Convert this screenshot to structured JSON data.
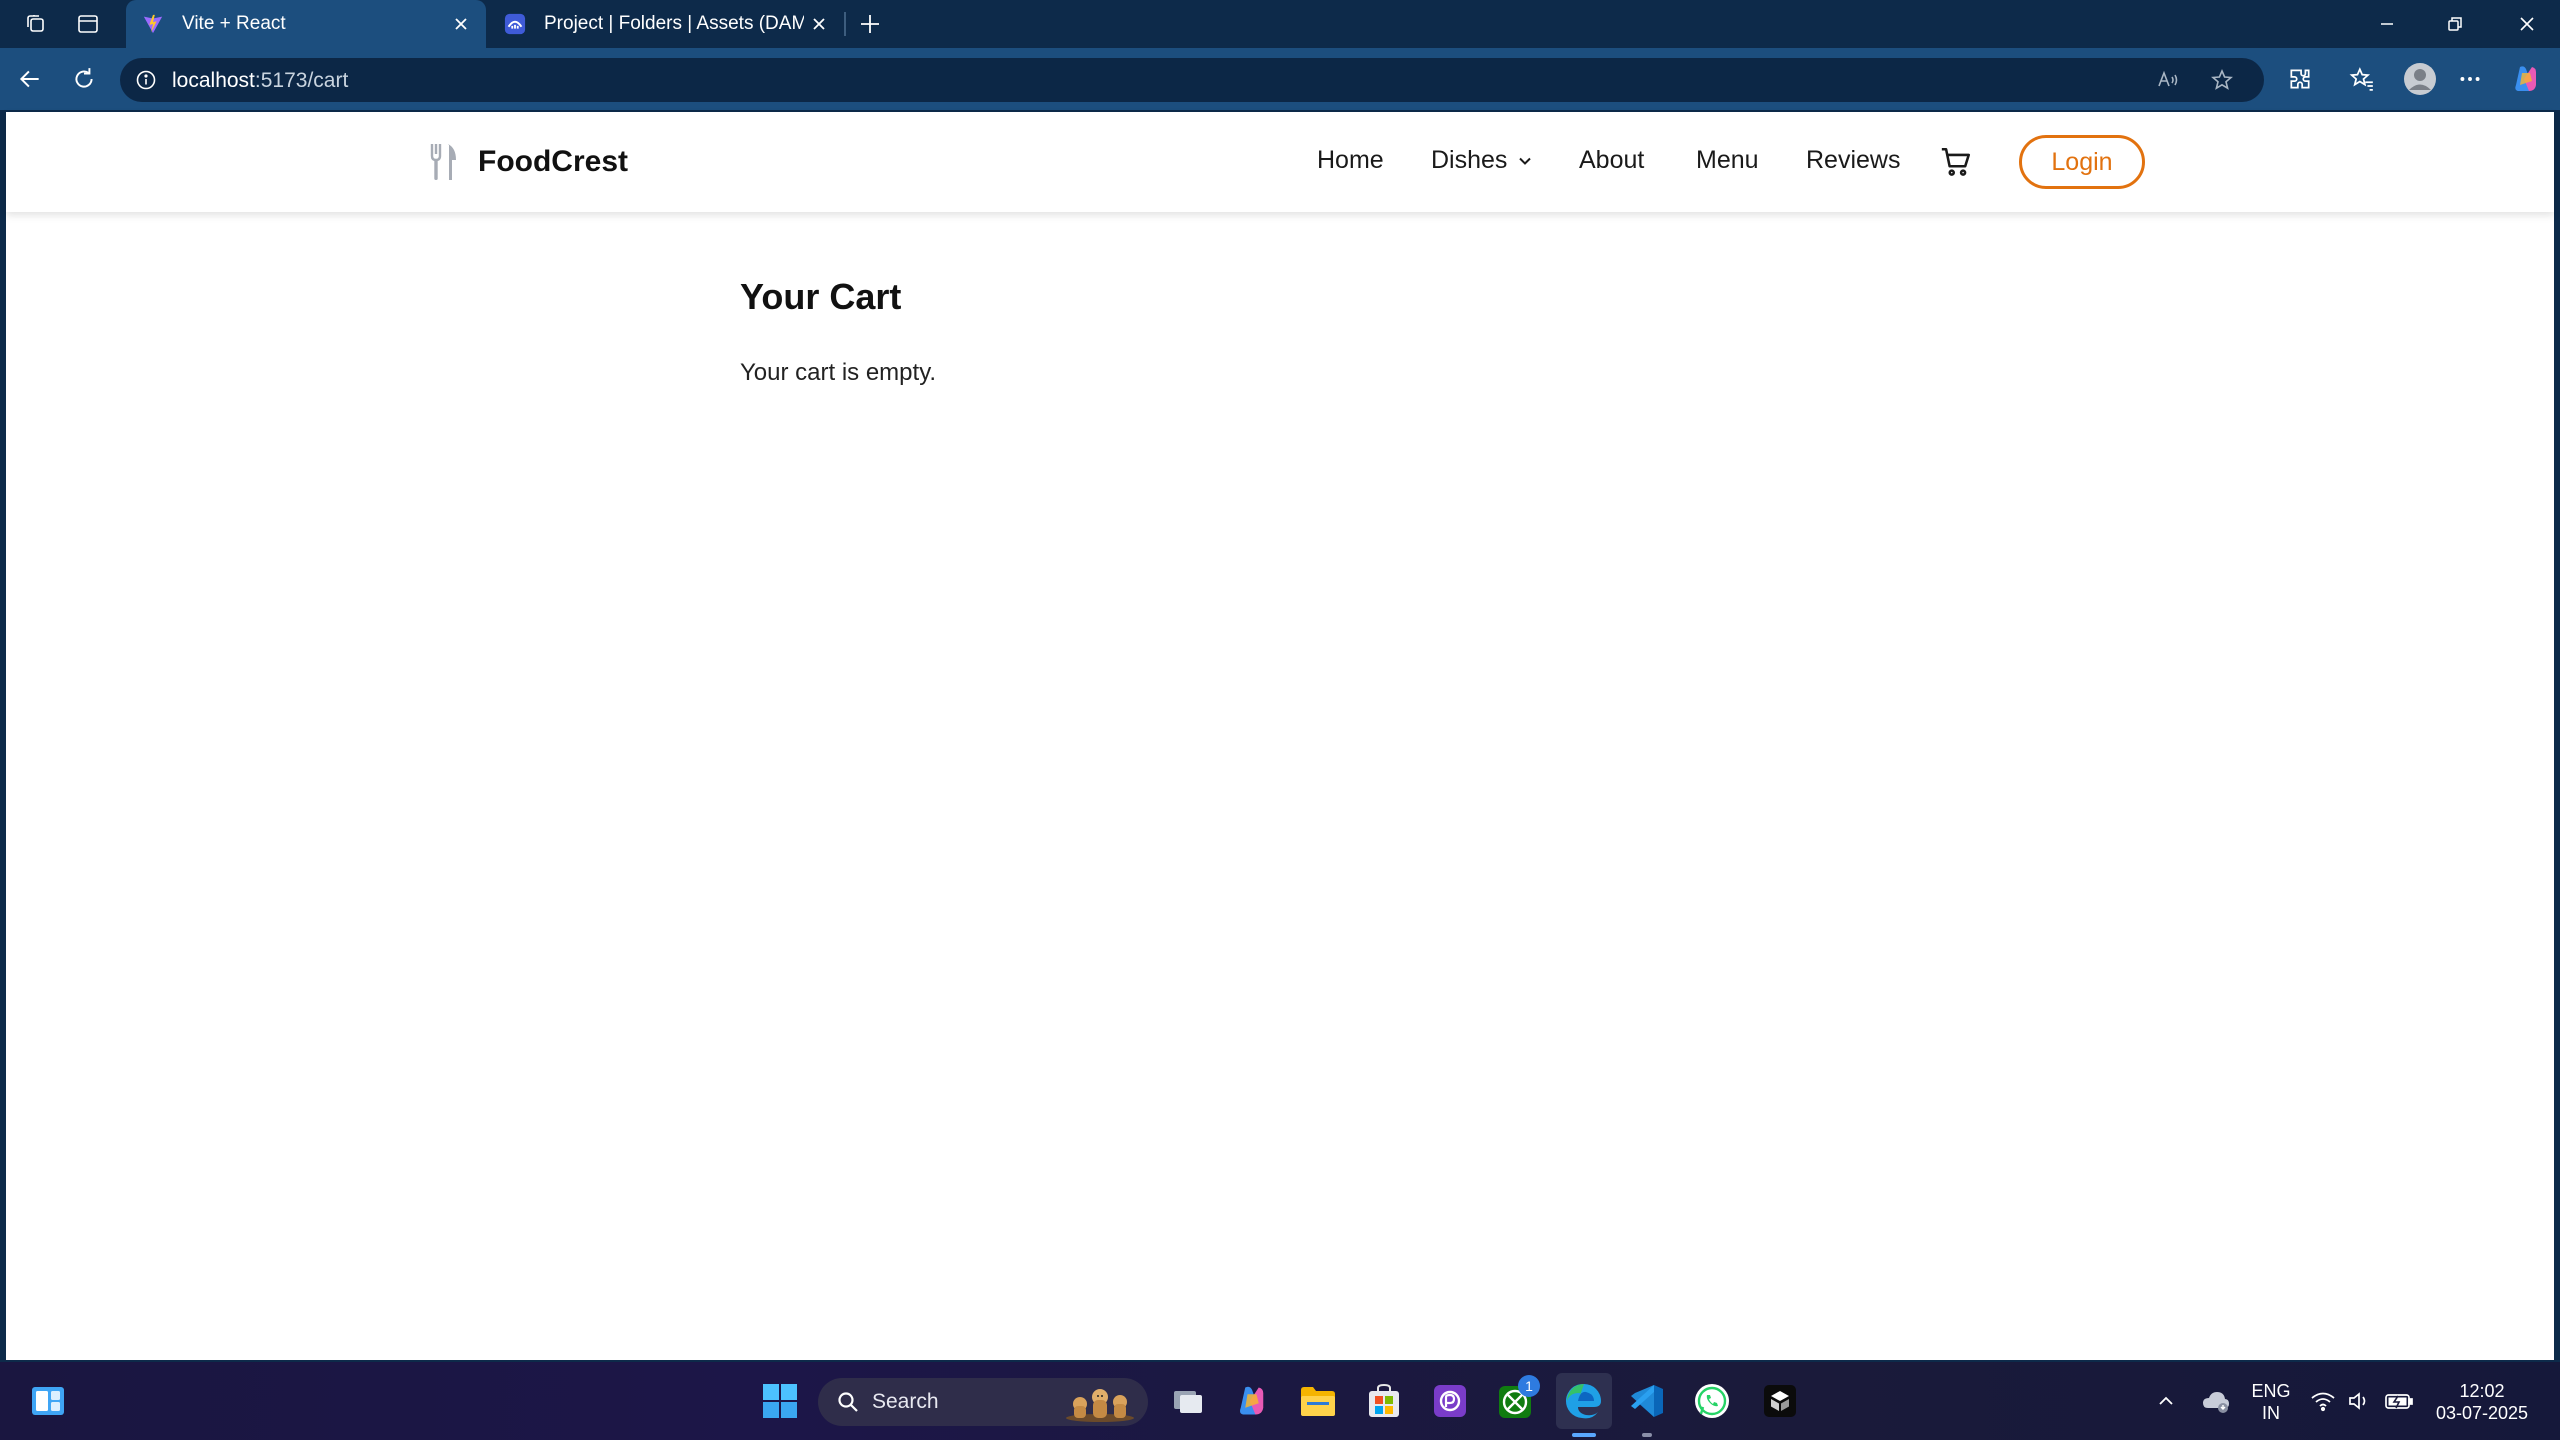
{
  "browser": {
    "tabs": [
      {
        "title": "Vite + React",
        "active": true,
        "favicon": "vite-icon"
      },
      {
        "title": "Project | Folders | Assets (DAM) | ",
        "active": false,
        "favicon": "dam-icon"
      }
    ],
    "address": {
      "host": "localhost",
      "path": ":5173/cart"
    }
  },
  "site": {
    "brand": "FoodCrest",
    "nav": {
      "home": "Home",
      "dishes": "Dishes",
      "about": "About",
      "menu": "Menu",
      "reviews": "Reviews",
      "login": "Login"
    },
    "accent_color": "#e2720f"
  },
  "cart": {
    "title": "Your Cart",
    "empty_message": "Your cart is empty."
  },
  "taskbar": {
    "search_label": "Search",
    "xbox_badge": "1",
    "language": {
      "line1": "ENG",
      "line2": "IN"
    },
    "clock": {
      "time": "12:02",
      "date": "03-07-2025"
    }
  }
}
